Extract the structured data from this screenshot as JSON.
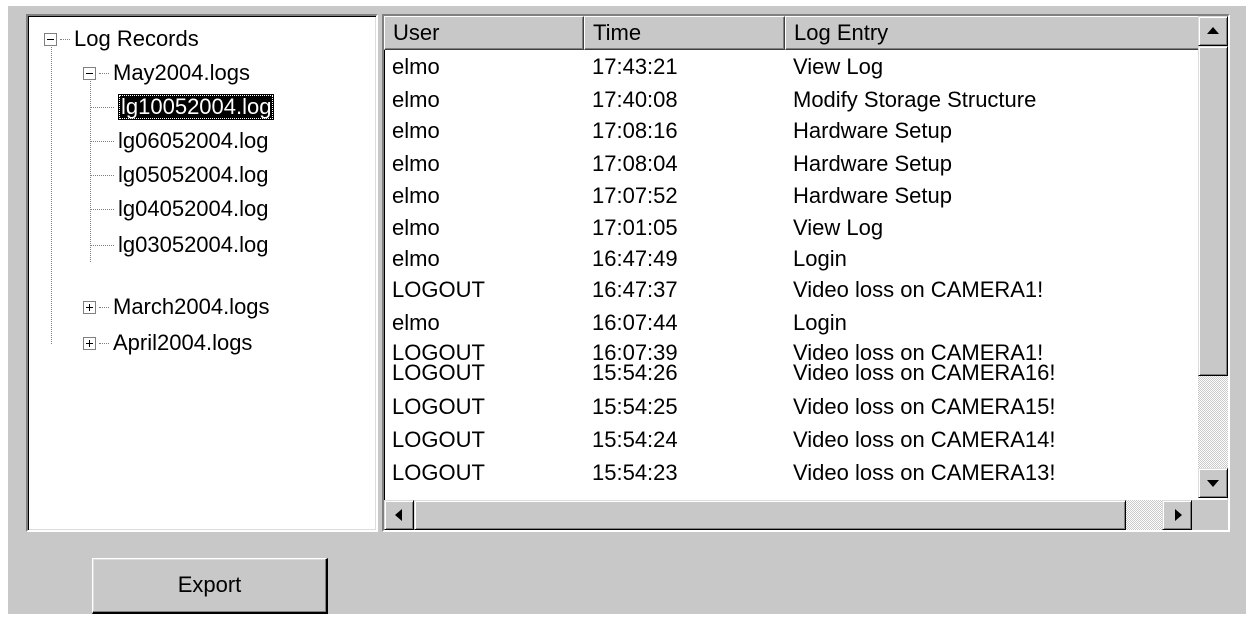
{
  "tree": {
    "root": {
      "label": "Log Records",
      "expander": "minus"
    },
    "groups": [
      {
        "label": "May2004.logs",
        "expander": "minus",
        "files": [
          {
            "label": "lg10052004.log",
            "selected": true
          },
          {
            "label": "lg06052004.log",
            "selected": false
          },
          {
            "label": "lg05052004.log",
            "selected": false
          },
          {
            "label": "lg04052004.log",
            "selected": false
          },
          {
            "label": "lg03052004.log",
            "selected": false
          }
        ]
      },
      {
        "label": "March2004.logs",
        "expander": "plus"
      },
      {
        "label": "April2004.logs",
        "expander": "plus"
      }
    ]
  },
  "table": {
    "columns": [
      "User",
      "Time",
      "Log Entry"
    ],
    "rows": [
      [
        "elmo",
        "17:43:21",
        "View Log"
      ],
      [
        "elmo",
        "17:40:08",
        "Modify Storage Structure"
      ],
      [
        "elmo",
        "17:08:16",
        "Hardware Setup"
      ],
      [
        "elmo",
        "17:08:04",
        "Hardware Setup"
      ],
      [
        "elmo",
        "17:07:52",
        "Hardware Setup"
      ],
      [
        "elmo",
        "17:01:05",
        "View Log"
      ],
      [
        "elmo",
        "16:47:49",
        "Login"
      ],
      [
        "LOGOUT",
        "16:47:37",
        "Video loss on  CAMERA1!"
      ],
      [
        "elmo",
        "16:07:44",
        "Login"
      ],
      [
        "LOGOUT",
        "16:07:39",
        "Video loss on  CAMERA1!"
      ],
      [
        "LOGOUT",
        "15:54:26",
        "Video loss on  CAMERA16!"
      ],
      [
        "LOGOUT",
        "15:54:25",
        "Video loss on  CAMERA15!"
      ],
      [
        "LOGOUT",
        "15:54:24",
        "Video loss on  CAMERA14!"
      ],
      [
        "LOGOUT",
        "15:54:23",
        "Video loss on  CAMERA13!"
      ]
    ]
  },
  "buttons": {
    "export_label": "Export"
  },
  "icons": {
    "scroll_up": "arrow-up-icon",
    "scroll_down": "arrow-down-icon",
    "scroll_left": "arrow-left-icon",
    "scroll_right": "arrow-right-icon"
  }
}
